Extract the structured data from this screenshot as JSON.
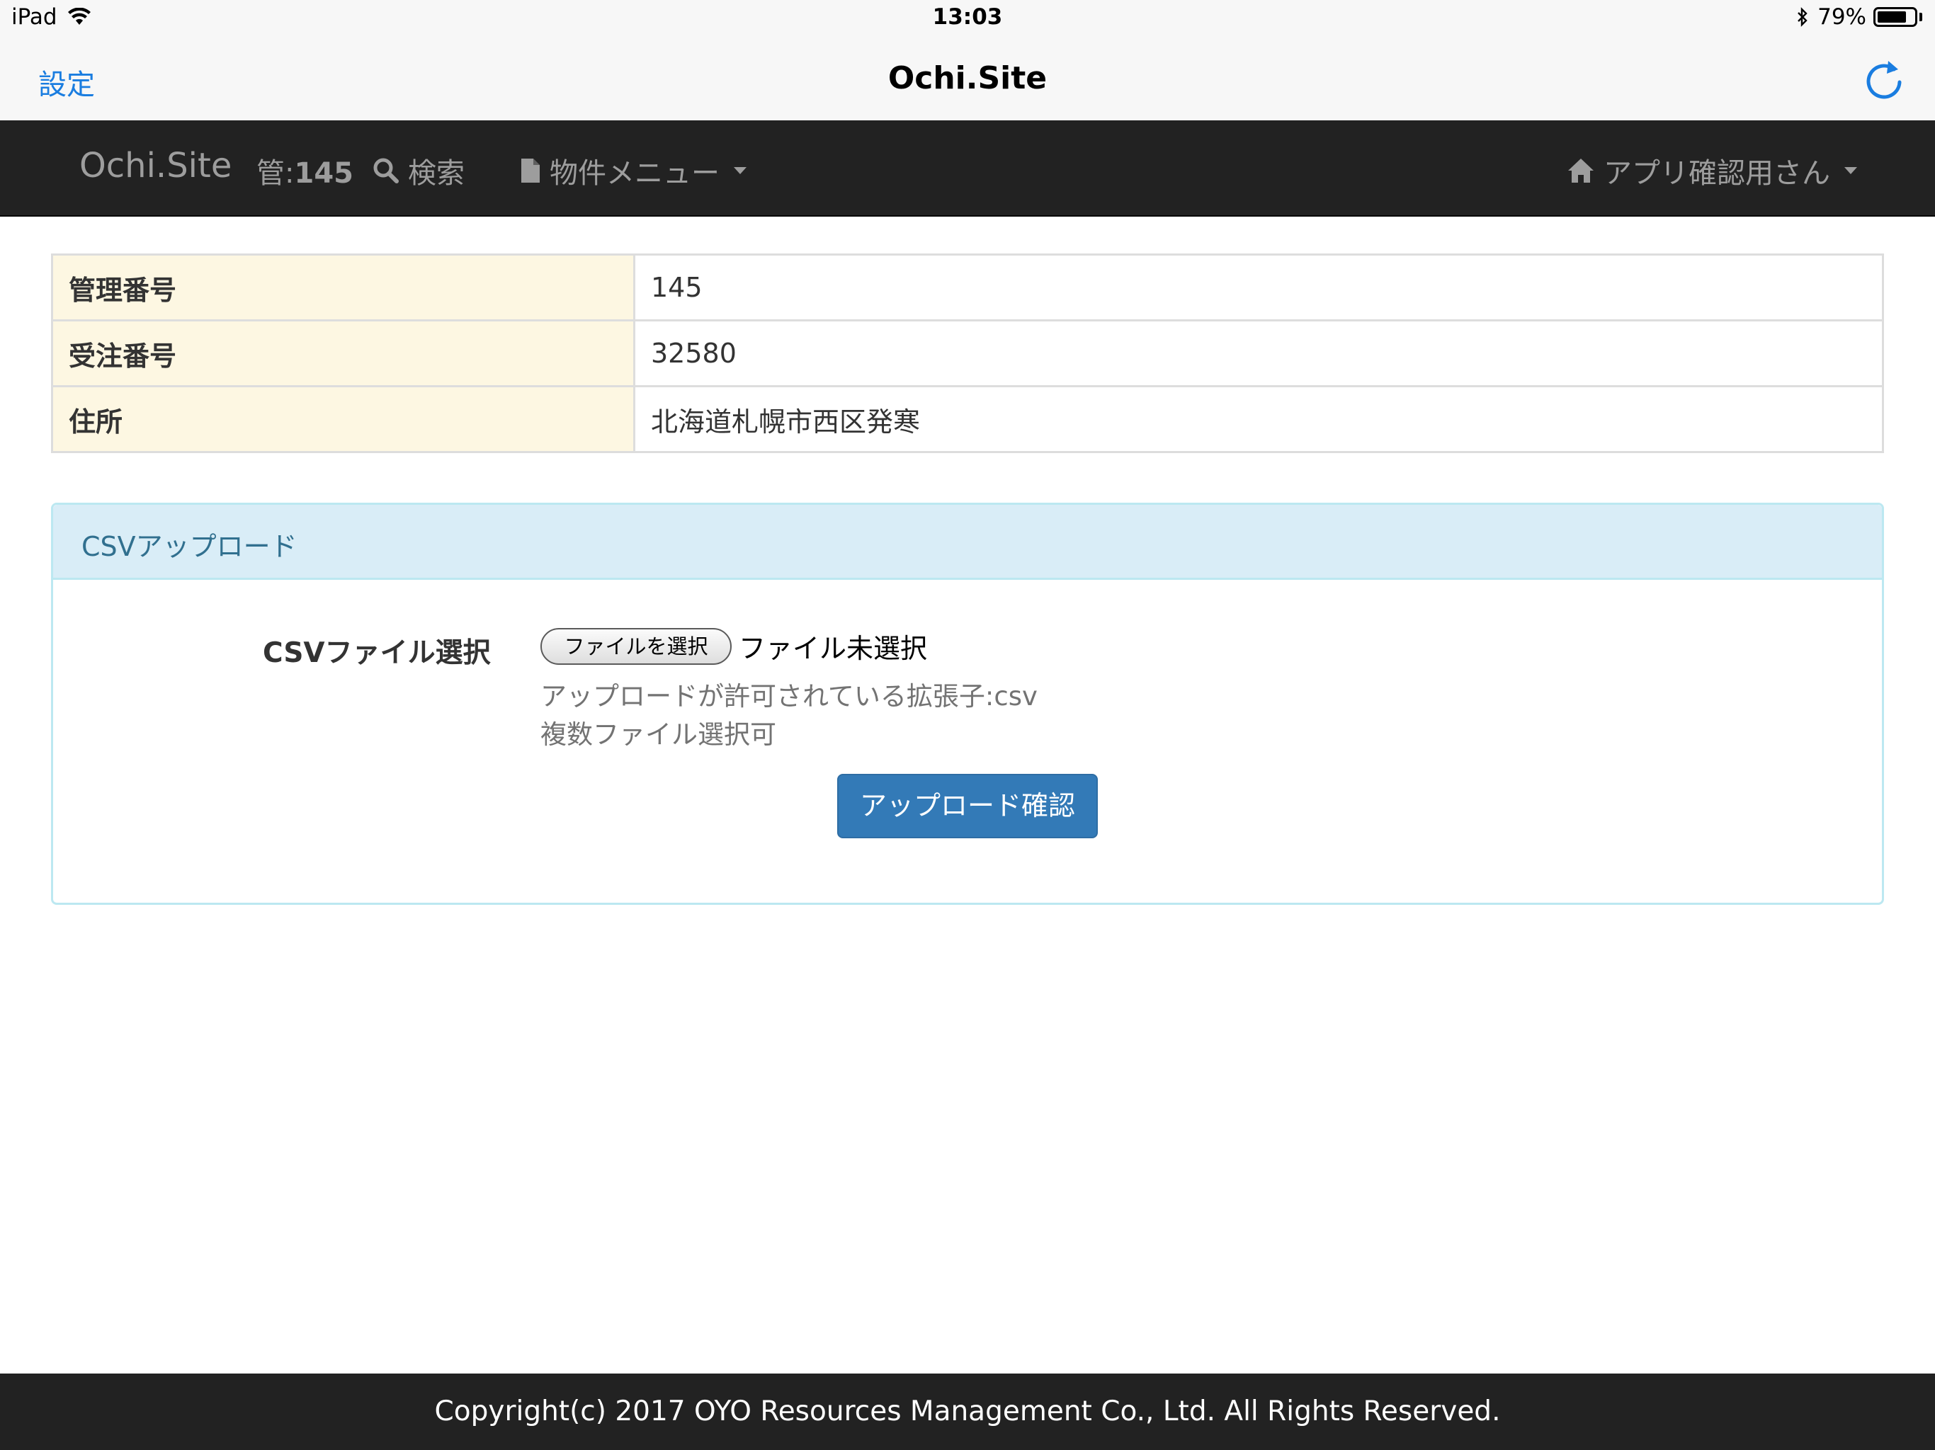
{
  "status_bar": {
    "device": "iPad",
    "time": "13:03",
    "battery": "79%",
    "battery_level": 0.79
  },
  "ios_nav": {
    "back_label": "設定",
    "title": "Ochi.Site"
  },
  "navbar": {
    "brand": "Ochi.Site",
    "kanri_prefix": "管:",
    "kanri_number": "145",
    "search_label": "検索",
    "menu_label": "物件メニュー",
    "user_label": "アプリ確認用さん"
  },
  "info_table": {
    "rows": [
      {
        "label": "管理番号",
        "value": "145"
      },
      {
        "label": "受注番号",
        "value": "32580"
      },
      {
        "label": "住所",
        "value": "北海道札幌市西区発寒"
      }
    ]
  },
  "upload_panel": {
    "heading": "CSVアップロード",
    "field_label": "CSVファイル選択",
    "file_button_label": "ファイルを選択",
    "file_status": "ファイル未選択",
    "help_extensions": "アップロードが許可されている拡張子:csv",
    "help_multiple": "複数ファイル選択可",
    "submit_label": "アップロード確認"
  },
  "footer": {
    "copyright": "Copyright(c) 2017 OYO Resources Management Co., Ltd. All Rights Reserved."
  },
  "colors": {
    "ios_blue": "#1a7de0",
    "navbar_bg": "#222222",
    "panel_heading_bg": "#d9edf7",
    "table_header_bg": "#fdf7e2",
    "primary_button": "#337ab7"
  }
}
